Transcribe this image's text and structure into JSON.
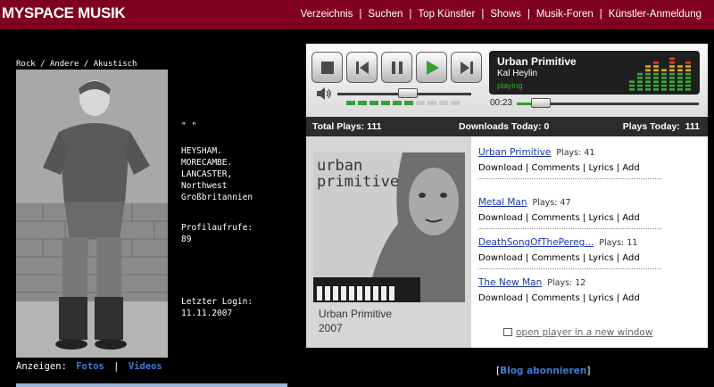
{
  "header": {
    "logo": "MYSPACE MUSIK",
    "nav": [
      "Verzeichnis",
      "Suchen",
      "Top Künstler",
      "Shows",
      "Musik-Foren",
      "Künstler-Anmeldung"
    ]
  },
  "profile": {
    "genre": "Rock / Andere / Akustisch",
    "quote": "\" \"",
    "location": [
      "HEYSHAM.",
      "MORECAMBE.",
      "LANCASTER,",
      "Northwest",
      "Großbritannien"
    ],
    "views_label": "Profilaufrufe:",
    "views_value": "89",
    "login_label": "Letzter Login:",
    "login_value": "11.11.2007",
    "show_label": "Anzeigen:",
    "show_fotos": "Fotos",
    "show_sep": "|",
    "show_videos": "Videos"
  },
  "player": {
    "now_title": "Urban Primitive",
    "now_artist": "Kal Heylin",
    "now_status": "playing",
    "time": "00:23",
    "volume_fraction": 0.6,
    "progress_fraction": 0.08,
    "stats": {
      "total_plays": "Total Plays: 111",
      "downloads_today": "Downloads Today: 0",
      "plays_today": "Plays Today:  111"
    },
    "album": {
      "cover_text_line1": "urban",
      "cover_text_line2": "primitive",
      "title": "Urban Primitive",
      "year": "2007"
    },
    "songs": [
      {
        "name": "Urban Primitive",
        "plays": "Plays: 41"
      },
      {
        "name": "Metal Man",
        "plays": "Plays: 47"
      },
      {
        "name": "DeathSongOfThePereg...",
        "plays": "Plays: 11"
      },
      {
        "name": "The New Man",
        "plays": "Plays: 12"
      }
    ],
    "song_actions": {
      "download": "Download",
      "comments": "Comments",
      "lyrics": "Lyrics",
      "add": "Add",
      "sep": "|"
    },
    "open_player": "open player in a new window",
    "colors": {
      "accent_green": "#35a035",
      "link_blue": "#1a39a8",
      "brand": "#800020"
    }
  },
  "blog": {
    "open": "[",
    "link": "Blog abonnieren",
    "close": "]"
  }
}
